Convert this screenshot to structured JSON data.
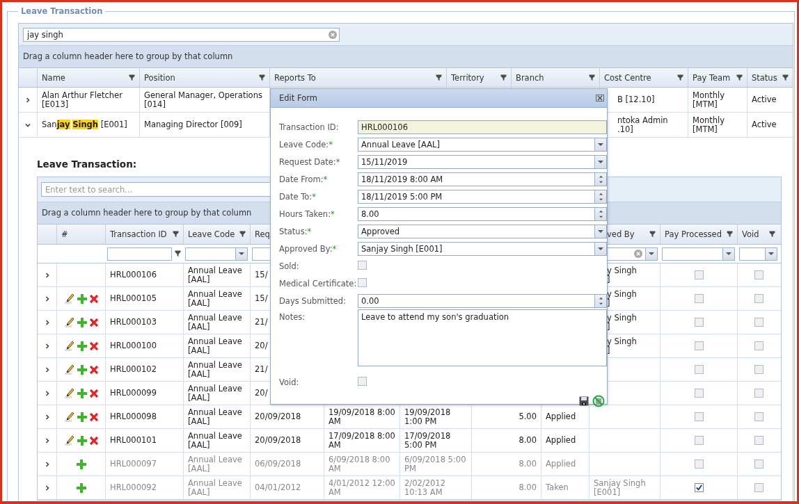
{
  "panel": {
    "legend": "Leave Transaction"
  },
  "employee_grid": {
    "search": {
      "value": "jay singh"
    },
    "group_panel": "Drag a column header here to group by that column",
    "columns": [
      "Name",
      "Position",
      "Reports To",
      "Territory",
      "Branch",
      "Cost Centre",
      "Pay Team",
      "Status"
    ],
    "rows": [
      {
        "expanded": false,
        "name": "Alan Arthur Fletcher [E013]",
        "position": "General Manager, Operations [014]",
        "cost_centre": [
          "B [12.10]"
        ],
        "pay_team": "Monthly [MTM]",
        "status": "Active"
      },
      {
        "expanded": true,
        "name": "San**jay** **Singh** [E001]",
        "position": "Managing Director [009]",
        "cost_centre": [
          "ntoka Admin",
          ".10]"
        ],
        "pay_team": "Monthly [MTM]",
        "status": "Active"
      }
    ]
  },
  "leave_grid": {
    "heading": "Leave Transaction:",
    "search": {
      "placeholder": "Enter text to search..."
    },
    "group_panel": "Drag a column header here to group by that column",
    "headers": {
      "number": "#",
      "transaction_id": "Transaction ID",
      "leave_code": "Leave Code",
      "request_date": "Req",
      "approved_by": "ved By",
      "pay_processed": "Pay Processed",
      "void": "Void"
    },
    "rows": [
      {
        "disabled": false,
        "can_edit": false,
        "can_add": false,
        "can_delete": false,
        "transaction_id": "HRL000106",
        "leave_code": "Annual Leave [AAL]",
        "request_date": "15/",
        "approved_by": [
          "y Singh",
          "]"
        ],
        "pay_processed": false,
        "void": false
      },
      {
        "disabled": false,
        "can_edit": true,
        "can_add": true,
        "can_delete": true,
        "transaction_id": "HRL000105",
        "leave_code": "Annual Leave [AAL]",
        "request_date": "15/",
        "approved_by": [
          "y Singh",
          "]"
        ],
        "pay_processed": false,
        "void": false
      },
      {
        "disabled": false,
        "can_edit": true,
        "can_add": true,
        "can_delete": true,
        "transaction_id": "HRL000103",
        "leave_code": "Annual Leave [AAL]",
        "request_date": "21/",
        "approved_by": [
          "y Singh",
          "]"
        ],
        "pay_processed": false,
        "void": false
      },
      {
        "disabled": false,
        "can_edit": true,
        "can_add": true,
        "can_delete": true,
        "transaction_id": "HRL000100",
        "leave_code": "Annual Leave [AAL]",
        "request_date": "20/",
        "approved_by": [
          "y Singh",
          "]"
        ],
        "pay_processed": false,
        "void": false
      },
      {
        "disabled": false,
        "can_edit": true,
        "can_add": true,
        "can_delete": true,
        "transaction_id": "HRL000102",
        "leave_code": "Annual Leave [AAL]",
        "request_date": "21/",
        "pay_processed": false,
        "void": false
      },
      {
        "disabled": false,
        "can_edit": true,
        "can_add": true,
        "can_delete": true,
        "transaction_id": "HRL000099",
        "leave_code": "Annual Leave [AAL]",
        "request_date": "20/",
        "pay_processed": false,
        "void": false
      },
      {
        "disabled": false,
        "can_edit": true,
        "can_add": true,
        "can_delete": true,
        "transaction_id": "HRL000098",
        "leave_code": "Annual Leave [AAL]",
        "request_date": "20/09/2018",
        "date_from": "19/09/2018 8:00 AM",
        "date_to": "19/09/2018 1:00 PM",
        "hours": "5.00",
        "status": "Applied",
        "pay_processed": false,
        "void": false
      },
      {
        "disabled": false,
        "can_edit": true,
        "can_add": true,
        "can_delete": true,
        "transaction_id": "HRL000101",
        "leave_code": "Annual Leave [AAL]",
        "request_date": "20/09/2018",
        "date_from": "17/09/2018 8:00 AM",
        "date_to": "17/09/2018 5:00 PM",
        "hours": "8.00",
        "status": "Applied",
        "pay_processed": false,
        "void": false
      },
      {
        "disabled": true,
        "can_edit": false,
        "can_add": true,
        "can_delete": false,
        "transaction_id": "HRL000097",
        "leave_code": "Annual Leave [AAL]",
        "request_date": "06/09/2018",
        "date_from": "6/09/2018 8:00 AM",
        "date_to": "6/09/2018 5:00 PM",
        "hours": "8.00",
        "status": "Applied",
        "pay_processed": false,
        "void": false
      },
      {
        "disabled": true,
        "can_edit": false,
        "can_add": true,
        "can_delete": false,
        "transaction_id": "HRL000092",
        "leave_code": "Annual Leave [AAL]",
        "request_date": "04/01/2012",
        "date_from": "4/01/2012 12:00 AM",
        "date_to": "2/02/2012 10:13 AM",
        "hours": "8.00",
        "status": "Taken",
        "approved_by": [
          "Sanjay Singh",
          "[E001]"
        ],
        "pay_processed": true,
        "void": false
      }
    ]
  },
  "edit_form": {
    "title": "Edit Form",
    "fields": [
      {
        "kind": "readonly",
        "label": "Transaction ID:",
        "value": "HRL000106"
      },
      {
        "kind": "dropdown",
        "label": "Leave Code:",
        "asterisk": "*",
        "value": "Annual Leave [AAL]"
      },
      {
        "kind": "dropdown",
        "label": "Request Date:",
        "asterisk": "*",
        "value": "15/11/2019"
      },
      {
        "kind": "spin",
        "label": "Date From:",
        "asterisk": "*",
        "value": "18/11/2019 8:00 AM"
      },
      {
        "kind": "spin",
        "label": "Date To:",
        "asterisk": "*",
        "value": "18/11/2019 5:00 PM"
      },
      {
        "kind": "spin",
        "label": "Hours Taken:",
        "asterisk": "*",
        "value": "8.00"
      },
      {
        "kind": "dropdown",
        "label": "Status:",
        "asterisk": "*",
        "value": "Approved"
      },
      {
        "kind": "dropdown",
        "label": "Approved By:",
        "asterisk": "*",
        "value": "Sanjay Singh [E001]"
      },
      {
        "kind": "checkbox",
        "label": "Sold:",
        "checked": false
      },
      {
        "kind": "checkbox",
        "label": "Medical Certificate:",
        "checked": false
      },
      {
        "kind": "spin",
        "label": "Days Submitted:",
        "value": "0.00"
      },
      {
        "kind": "textarea",
        "label": "Notes:",
        "value": "Leave to attend my son's graduation"
      },
      {
        "kind": "checkbox",
        "label": "Void:",
        "checked": false
      }
    ]
  }
}
